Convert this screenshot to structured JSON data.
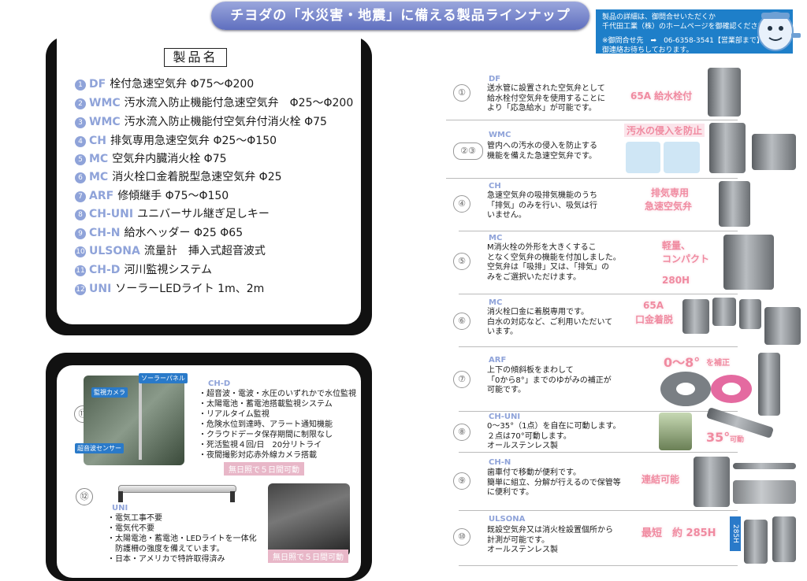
{
  "banner": "チヨダの「水災害・地震」に備える製品ラインナップ",
  "info": {
    "line1": "製品の詳細は、御問合せいただくか",
    "line2": "千代田工業（株）のホームページを御確認ください。",
    "line3": "※御問合せ先　➡　06-6358-3541【営業部まで】",
    "line4": "御連絡お待ちしております。"
  },
  "products_title": "製品名",
  "products": [
    {
      "num": "1",
      "code": "DF",
      "name": "栓付急速空気弁 Φ75～Φ200"
    },
    {
      "num": "2",
      "code": "WMC",
      "name": "汚水流入防止機能付急速空気弁　Φ25～Φ200"
    },
    {
      "num": "3",
      "code": "WMC",
      "name": "汚水流入防止機能付空気弁付消火栓 Φ75"
    },
    {
      "num": "4",
      "code": "CH",
      "name": "排気専用急速空気弁 Φ25～Φ150"
    },
    {
      "num": "5",
      "code": "MC",
      "name": "空気弁内臓消火栓 Φ75"
    },
    {
      "num": "6",
      "code": "MC",
      "name": "消火栓口金着脱型急速空気弁 Φ25"
    },
    {
      "num": "7",
      "code": "ARF",
      "name": "修傾継手 Φ75～Φ150"
    },
    {
      "num": "8",
      "code": "CH-UNI",
      "name": "ユニバーサル継ぎ足しキー"
    },
    {
      "num": "9",
      "code": "CH-N",
      "name": "給水ヘッダー Φ25 Φ65"
    },
    {
      "num": "10",
      "code": "ULSONA",
      "name": "流量計　挿入式超音波式"
    },
    {
      "num": "11",
      "code": "CH-D",
      "name": "河川監視システム"
    },
    {
      "num": "12",
      "code": "UNI",
      "name": "ソーラーLEDライト 1m、2m"
    }
  ],
  "p11": {
    "num": "⑪",
    "tags": {
      "camera": "監視カメラ",
      "solar": "ソーラーパネル",
      "sensor": "超音波センサー"
    },
    "head": "CH-D",
    "bullets": [
      "・超音波・電波・水圧のいずれかで水位監視",
      "・太陽電池・蓄電池搭載監視システム",
      "・リアルタイム監視",
      "・危険水位到達時、アラート通知機能",
      "・クラウドデータ保存期間に制限なし",
      "・死活監視４回/日　20分リトライ",
      "・夜間撮影対応赤外線カメラ搭載"
    ],
    "note": "無日照で５日間可動"
  },
  "p12": {
    "num": "⑫",
    "head": "UNI",
    "bullets": [
      "・電気工事不要",
      "・電気代不要",
      "・太陽電池・蓄電池・LEDライトを一体化",
      "　防護柵の強度を備えています。",
      "・日本・アメリカで特許取得済み"
    ],
    "note": "無日照で５日間可動"
  },
  "rows": [
    {
      "num": "①",
      "code": "DF",
      "desc": [
        "送水管に設置された空気弁として",
        "給水栓付空気弁を使用することに",
        "より「応急給水」が可能です。"
      ],
      "badge": "65A 給水栓付"
    },
    {
      "num": "②③",
      "code": "WMC",
      "desc": [
        "管内への汚水の侵入を防止する",
        "機能を備えた急速空気弁です。"
      ],
      "badge": "汚水の侵入を防止"
    },
    {
      "num": "④",
      "code": "CH",
      "desc": [
        "急速空気弁の吸排気機能のうち",
        "「排気」のみを行い、吸気は行",
        "いません。"
      ],
      "badge": "排気専用",
      "badge_b": "急速空気弁"
    },
    {
      "num": "⑤",
      "code": "MC",
      "desc": [
        "M消火栓の外形を大きくするこ",
        "となく空気弁の機能を付加しました。",
        "空気弁は「吸排」又は、「排気」の",
        "みをご選択いただけます。"
      ],
      "badge": "軽量、",
      "badge_b": "コンパクト",
      "badge_c": "280H"
    },
    {
      "num": "⑥",
      "code": "MC",
      "desc": [
        "消火栓口金に着脱専用です。",
        "白水の対応など、ご利用いただいて",
        "います。"
      ],
      "badge": "65A",
      "badge_b": "口金着脱"
    },
    {
      "num": "⑦",
      "code": "ARF",
      "desc": [
        "上下の傾斜板をまわして",
        "「0から8°」までのゆがみの補正が",
        "可能です。"
      ],
      "badge": "0～8°",
      "badge_b": "を補正"
    },
    {
      "num": "⑧",
      "code": "CH-UNI",
      "desc": [
        "0～35°（1点）を自在に可動します。",
        "２点は70°可動します。",
        "オールステンレス製"
      ],
      "badge": "35°",
      "badge_b": "可動"
    },
    {
      "num": "⑨",
      "code": "CH-N",
      "desc": [
        "歯車付で移動が便利です。",
        "簡単に組立、分解が行えるので保管等",
        "に便利です。"
      ],
      "badge": "連結可能"
    },
    {
      "num": "⑩",
      "code": "ULSONA",
      "desc": [
        "既設空気弁又は消火栓設置個所から",
        "計測が可能です。",
        "オールステンレス製"
      ],
      "badge": "最短　約 285H",
      "badge_b": "285H"
    }
  ]
}
